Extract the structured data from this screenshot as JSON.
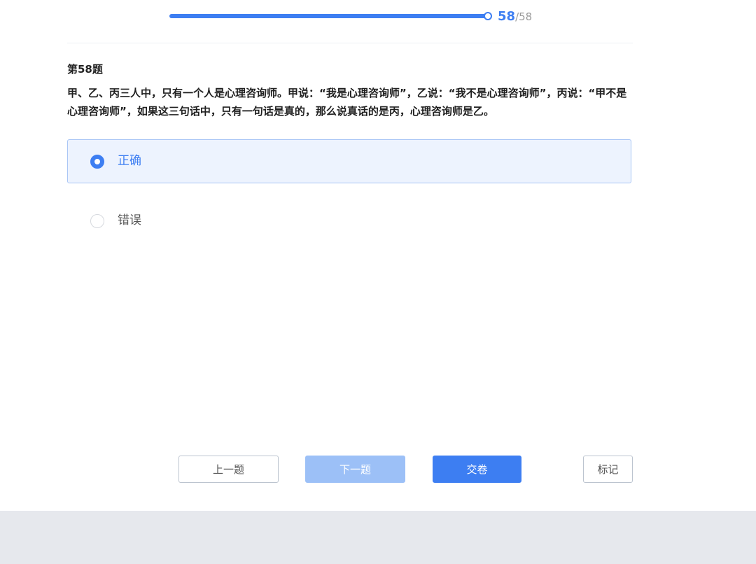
{
  "progress": {
    "current": "58",
    "separator": "/",
    "total": "58",
    "fraction": 1.0
  },
  "question": {
    "number_label": "第58题",
    "text": "甲、乙、丙三人中，只有一个人是心理咨询师。甲说：“我是心理咨询师”，乙说：“我不是心理咨询师”，丙说：“甲不是心理咨询师”，如果这三句话中，只有一句话是真的，那么说真话的是丙，心理咨询师是乙。"
  },
  "options": [
    {
      "label": "正确",
      "selected": true
    },
    {
      "label": "错误",
      "selected": false
    }
  ],
  "buttons": {
    "prev_label": "上一题",
    "next_label": "下一题",
    "submit_label": "交卷",
    "mark_label": "标记"
  },
  "colors": {
    "accent": "#3d7ef2",
    "accent_light": "#9cc0f7",
    "selected_bg": "#edf3fe",
    "selected_border": "#a9c6f5"
  }
}
